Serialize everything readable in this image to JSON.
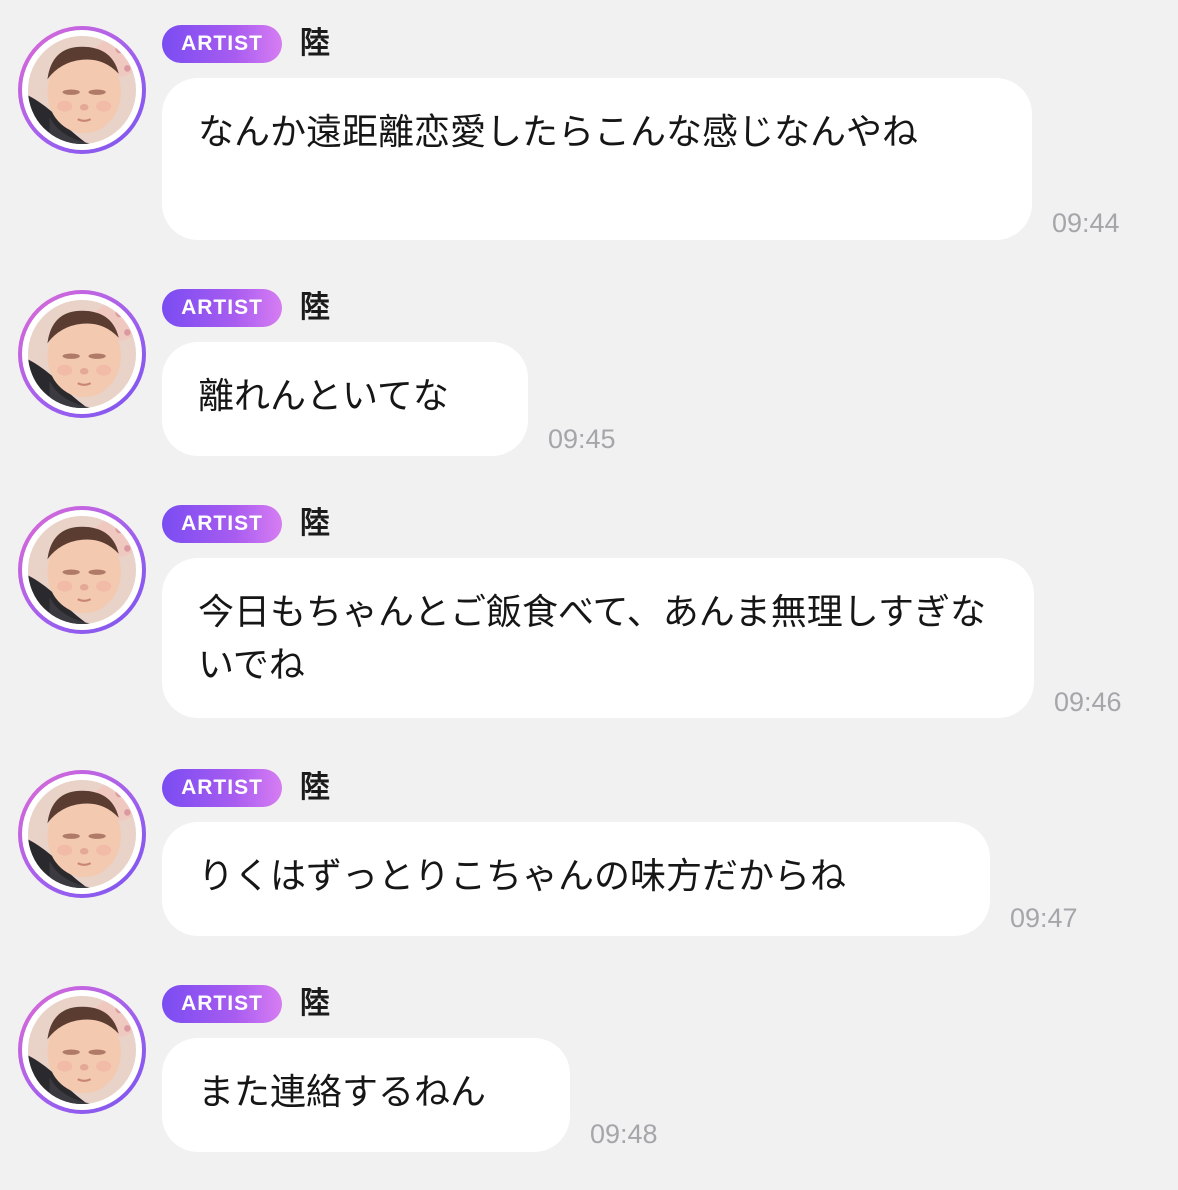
{
  "colors": {
    "background": "#f1f1f2",
    "bubble": "#ffffff",
    "badge_gradient_start": "#7a4cf2",
    "badge_gradient_end": "#d77df2",
    "timestamp": "#a6a6aa"
  },
  "messages": [
    {
      "badge": "ARTIST",
      "sender": "陸",
      "avatar_icon": "sleeping-baby-avatar",
      "text": "なんか遠距離恋愛したらこんな感じなんやね",
      "time": "09:44"
    },
    {
      "badge": "ARTIST",
      "sender": "陸",
      "avatar_icon": "sleeping-baby-avatar",
      "text": "離れんといてな",
      "time": "09:45"
    },
    {
      "badge": "ARTIST",
      "sender": "陸",
      "avatar_icon": "sleeping-baby-avatar",
      "text": "今日もちゃんとご飯食べて、あんま無理しすぎないでね",
      "time": "09:46"
    },
    {
      "badge": "ARTIST",
      "sender": "陸",
      "avatar_icon": "sleeping-baby-avatar",
      "text": "りくはずっとりこちゃんの味方だからね",
      "time": "09:47"
    },
    {
      "badge": "ARTIST",
      "sender": "陸",
      "avatar_icon": "sleeping-baby-avatar",
      "text": "また連絡するねん",
      "time": "09:48"
    }
  ]
}
